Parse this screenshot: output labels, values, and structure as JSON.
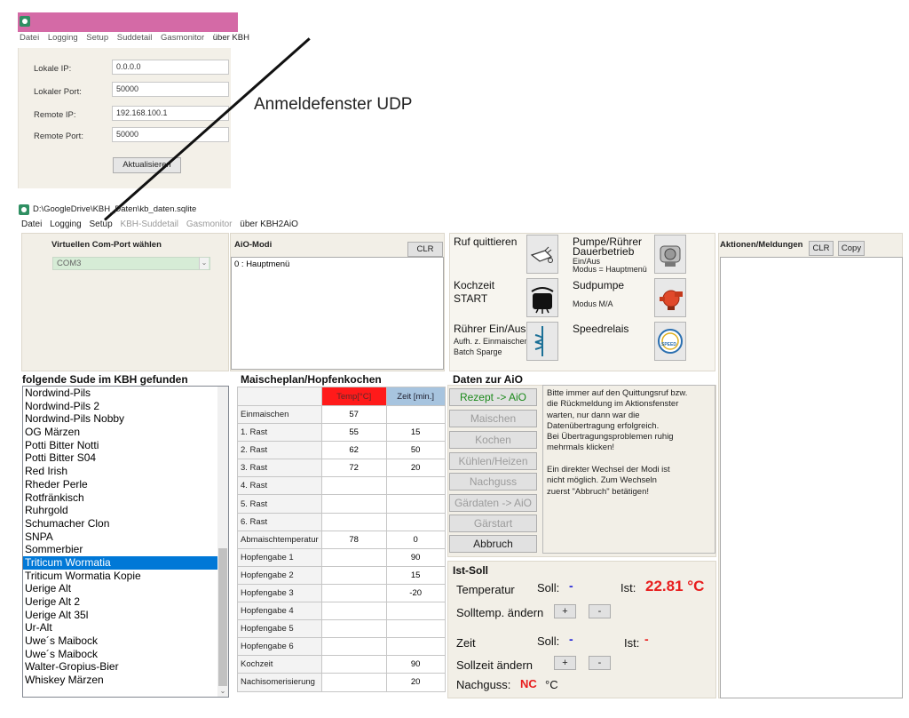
{
  "udp_window": {
    "menu": [
      "Datei",
      "Logging",
      "Setup",
      "Suddetail",
      "Gasmonitor",
      "über KBH"
    ],
    "fields": [
      {
        "label": "Lokale IP:",
        "value": "0.0.0.0"
      },
      {
        "label": "Lokaler Port:",
        "value": "50000"
      },
      {
        "label": "Remote IP:",
        "value": "192.168.100.1"
      },
      {
        "label": "Remote Port:",
        "value": "50000"
      }
    ],
    "button": "Aktualisieren"
  },
  "annotation": "Anmeldefenster UDP",
  "main_window": {
    "title": "D:\\GoogleDrive\\KBH_Daten\\kb_daten.sqlite",
    "menu": [
      "Datei",
      "Logging",
      "Setup",
      "KBH-Suddetail",
      "Gasmonitor",
      "über KBH2AiO"
    ]
  },
  "com": {
    "heading": "Virtuellen Com-Port wählen",
    "value": "COM3"
  },
  "aio_modi": {
    "heading": "AiO-Modi",
    "clr": "CLR",
    "content": "0 : Hauptmenü"
  },
  "controls": {
    "ruf_label": "Ruf quittieren",
    "pumpe": {
      "l1": "Pumpe/Rührer",
      "l2": "Dauerbetrieb",
      "l3": "Ein/Aus",
      "l4": "Modus = Hauptmenü"
    },
    "kochzeit": {
      "l1": "Kochzeit",
      "l2": "START"
    },
    "sudpumpe": {
      "l1": "Sudpumpe",
      "l2": "Modus M/A"
    },
    "ruehrer": {
      "l1": "Rührer Ein/Aus",
      "l2": "Aufh. z. Einmaischen",
      "l3": "Batch Sparge"
    },
    "speedrelais": "Speedrelais",
    "speed_icon_text": "SPEED"
  },
  "actions": {
    "heading": "Aktionen/Meldungen",
    "clr": "CLR",
    "copy": "Copy"
  },
  "sude": {
    "heading": "folgende Sude im KBH gefunden",
    "items": [
      "Nordwind-Pils",
      "Nordwind-Pils 2",
      "Nordwind-Pils Nobby",
      "OG Märzen",
      "Potti Bitter Notti",
      "Potti Bitter S04",
      "Red Irish",
      "Rheder Perle",
      "Rotfränkisch",
      "Ruhrgold",
      "Schumacher Clon",
      "SNPA",
      "Sommerbier",
      "Triticum Wormatia",
      "Triticum Wormatia Kopie",
      "Uerige Alt",
      "Uerige Alt 2",
      "Uerige Alt 35l",
      "Ur-Alt",
      "Uwe´s Maibock",
      "Uwe´s Maibock",
      "Walter-Gropius-Bier",
      "Whiskey Märzen"
    ],
    "selected": "Triticum Wormatia"
  },
  "maischplan": {
    "heading": "Maischeplan/Hopfenkochen",
    "col_temp": "Temp[°C]",
    "col_zeit": "Zeit [min.]",
    "rows": [
      [
        "Einmaischen",
        "57",
        ""
      ],
      [
        "1. Rast",
        "55",
        "15"
      ],
      [
        "2. Rast",
        "62",
        "50"
      ],
      [
        "3. Rast",
        "72",
        "20"
      ],
      [
        "4. Rast",
        "",
        ""
      ],
      [
        "5. Rast",
        "",
        ""
      ],
      [
        "6. Rast",
        "",
        ""
      ],
      [
        "Abmaischtemperatur",
        "78",
        "0"
      ],
      [
        "Hopfengabe 1",
        "",
        "90"
      ],
      [
        "Hopfengabe 2",
        "",
        "15"
      ],
      [
        "Hopfengabe 3",
        "",
        "-20"
      ],
      [
        "Hopfengabe 4",
        "",
        ""
      ],
      [
        "Hopfengabe 5",
        "",
        ""
      ],
      [
        "Hopfengabe 6",
        "",
        ""
      ],
      [
        "Kochzeit",
        "",
        "90"
      ],
      [
        "Nachisomerisierung",
        "",
        "20"
      ]
    ]
  },
  "daten_aio": {
    "heading": "Daten zur AiO",
    "buttons": [
      "Rezept -> AiO",
      "Maischen",
      "Kochen",
      "Kühlen/Heizen",
      "Nachguss",
      "Gärdaten -> AiO",
      "Gärstart",
      "Abbruch"
    ],
    "info_lines": [
      "Bitte immer auf den Quittungsruf bzw.",
      "die Rückmeldung im Aktionsfenster",
      "warten, nur dann war die",
      "Datenübertragung erfolgreich.",
      "Bei Übertragungsproblemen ruhig",
      "mehrmals klicken!",
      "",
      "Ein direkter Wechsel der Modi ist",
      "nicht möglich. Zum Wechseln",
      "zuerst \"Abbruch\" betätigen!"
    ]
  },
  "istsoll": {
    "heading": "Ist-Soll",
    "temperatur": "Temperatur",
    "soll": "Soll:",
    "soll_temp_value": "-",
    "ist": "Ist:",
    "ist_temp_value": "22.81 °C",
    "solltemp_aendern": "Solltemp. ändern",
    "plus": "+",
    "minus": "-",
    "zeit": "Zeit",
    "soll_zeit_value": "-",
    "ist_zeit_value": "-",
    "sollzeit_aendern": "Sollzeit ändern",
    "nachguss": "Nachguss:",
    "nachguss_value": "NC",
    "nachguss_unit": "°C"
  },
  "colors": {
    "selection": "#0078d7",
    "udp_titlebar": "#d46aa6",
    "temp_header": "#ff1a1a",
    "zeit_header": "#a7c4df",
    "ist_value": "#e81e1e"
  }
}
